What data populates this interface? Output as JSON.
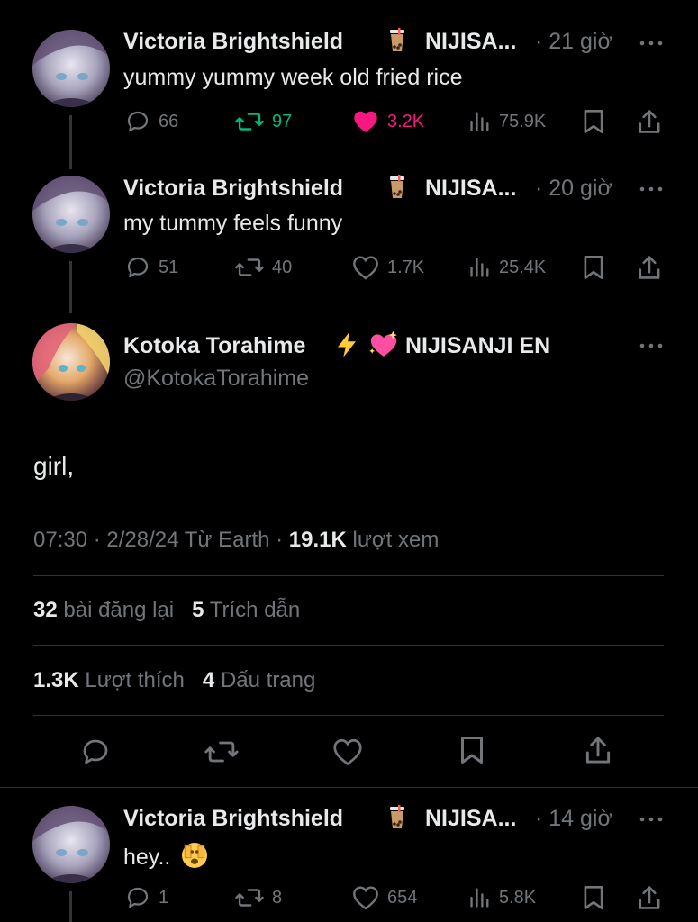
{
  "colors": {
    "background": "#000000",
    "text": "#e7e9ea",
    "muted": "#71767b",
    "retweet_active": "#00ba7c",
    "like_active": "#f91880",
    "divider": "#2f3336"
  },
  "reply1": {
    "name": "Victoria Brightshield",
    "org": "NIJISA...",
    "time": "· 21 giờ",
    "text": "yummy yummy week old fried rice",
    "replies": "66",
    "reposts": "97",
    "likes": "3.2K",
    "views": "75.9K"
  },
  "reply2": {
    "name": "Victoria Brightshield",
    "org": "NIJISA...",
    "time": "· 20 giờ",
    "text": "my tummy feels funny",
    "replies": "51",
    "reposts": "40",
    "likes": "1.7K",
    "views": "25.4K"
  },
  "main_post": {
    "name": "Kotoka Torahime",
    "org": "NIJISANJI EN",
    "handle": "@KotokaTorahime",
    "text": "girl,",
    "meta_time": "07:30 · 2/28/24 Từ Earth ·",
    "views_count": "19.1K",
    "views_label": "lượt xem",
    "reposts_count": "32",
    "reposts_label": "bài đăng lại",
    "quotes_count": "5",
    "quotes_label": "Trích dẫn",
    "likes_count": "1.3K",
    "likes_label": "Lượt thích",
    "bookmarks_count": "4",
    "bookmarks_label": "Dấu trang"
  },
  "reply3": {
    "name": "Victoria Brightshield",
    "org": "NIJISA...",
    "time": "· 14 giờ",
    "text": "hey..",
    "replies": "1",
    "reposts": "8",
    "likes": "654",
    "views": "5.8K"
  },
  "icons": {
    "reply": "reply-icon",
    "repost": "repost-icon",
    "like": "heart-icon",
    "views": "views-icon",
    "bookmark": "bookmark-icon",
    "share": "share-icon",
    "more": "more-icon",
    "bubble_tea": "bubble-tea-emoji",
    "lightning": "lightning-emoji",
    "sparkling_heart": "sparkling-heart-emoji",
    "peeking_face": "peeking-face-emoji"
  }
}
